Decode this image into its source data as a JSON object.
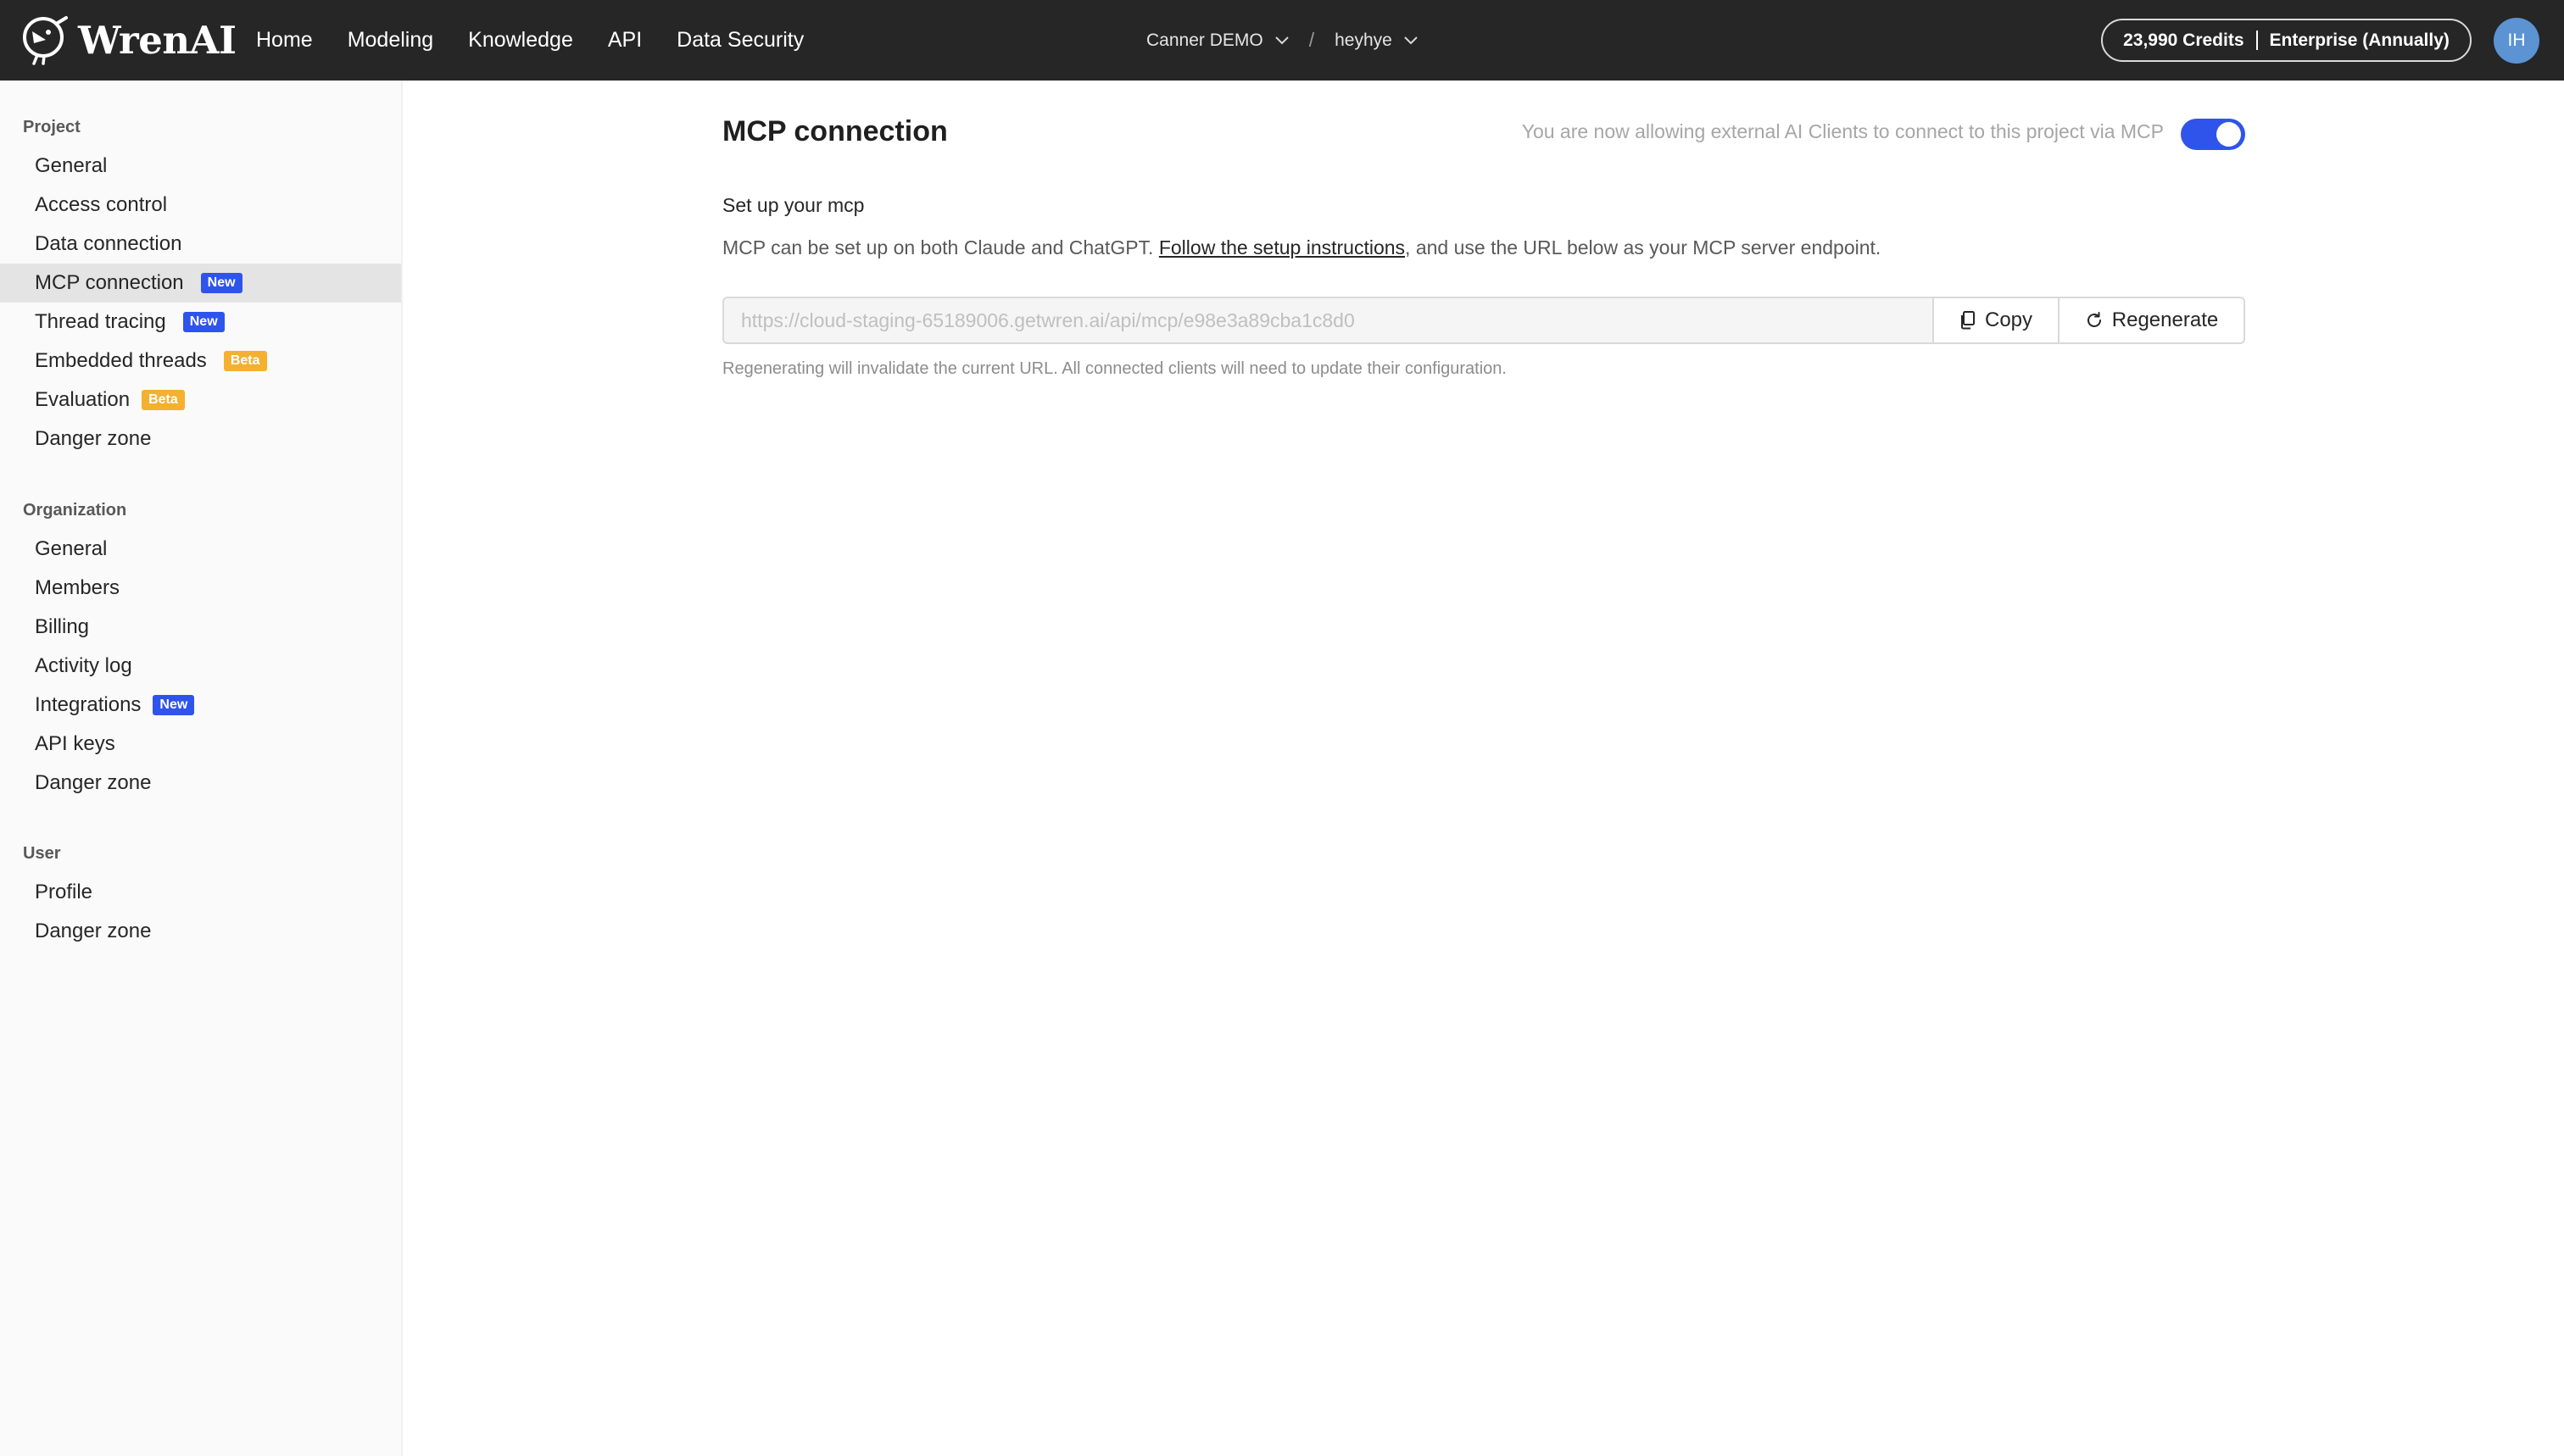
{
  "brand": {
    "name": "WrenAI",
    "logo_icon": "wren-bird-logo-icon"
  },
  "topnav": {
    "items": [
      {
        "label": "Home"
      },
      {
        "label": "Modeling"
      },
      {
        "label": "Knowledge"
      },
      {
        "label": "API"
      },
      {
        "label": "Data Security"
      }
    ]
  },
  "breadcrumb": {
    "organization": "Canner DEMO",
    "separator": "/",
    "project": "heyhye"
  },
  "account": {
    "credits": "23,990 Credits",
    "plan": "Enterprise (Annually)",
    "avatar_initials": "IH",
    "avatar_color": "#5b93d3"
  },
  "sidebar": {
    "project": {
      "title": "Project",
      "items": [
        {
          "label": "General"
        },
        {
          "label": "Access control"
        },
        {
          "label": "Data connection"
        },
        {
          "label": "MCP connection",
          "badge": "New",
          "active": true
        },
        {
          "label": "Thread tracing",
          "badge": "New"
        },
        {
          "label": "Embedded threads",
          "badge": "Beta"
        },
        {
          "label": "Evaluation",
          "badge": "Beta"
        },
        {
          "label": "Danger zone"
        }
      ]
    },
    "organization": {
      "title": "Organization",
      "items": [
        {
          "label": "General"
        },
        {
          "label": "Members"
        },
        {
          "label": "Billing"
        },
        {
          "label": "Activity log"
        },
        {
          "label": "Integrations",
          "badge": "New"
        },
        {
          "label": "API keys"
        },
        {
          "label": "Danger zone"
        }
      ]
    },
    "user": {
      "title": "User",
      "items": [
        {
          "label": "Profile"
        },
        {
          "label": "Danger zone"
        }
      ]
    }
  },
  "main": {
    "title": "MCP connection",
    "allow_text": "You are now allowing external AI Clients to connect to this project via MCP",
    "toggle_on": true,
    "subtitle": "Set up your mcp",
    "desc_prefix": "MCP can be set up on both Claude and ChatGPT. ",
    "desc_link": "Follow the setup instructions",
    "desc_suffix": ", and use the URL below as your MCP server endpoint.",
    "url_value": "https://cloud-staging-65189006.getwren.ai/api/mcp/e98e3a89cba1c8d0",
    "copy_label": "Copy",
    "regenerate_label": "Regenerate",
    "hint": "Regenerating will invalidate the current URL. All connected clients will need to update their configuration."
  },
  "colors": {
    "topbar": "#262626",
    "accent": "#2f54eb",
    "badge_new": "#2f54eb",
    "badge_beta": "#f4b030",
    "sidebar_bg": "#fafafa",
    "sidebar_active": "#e4e4e4"
  }
}
